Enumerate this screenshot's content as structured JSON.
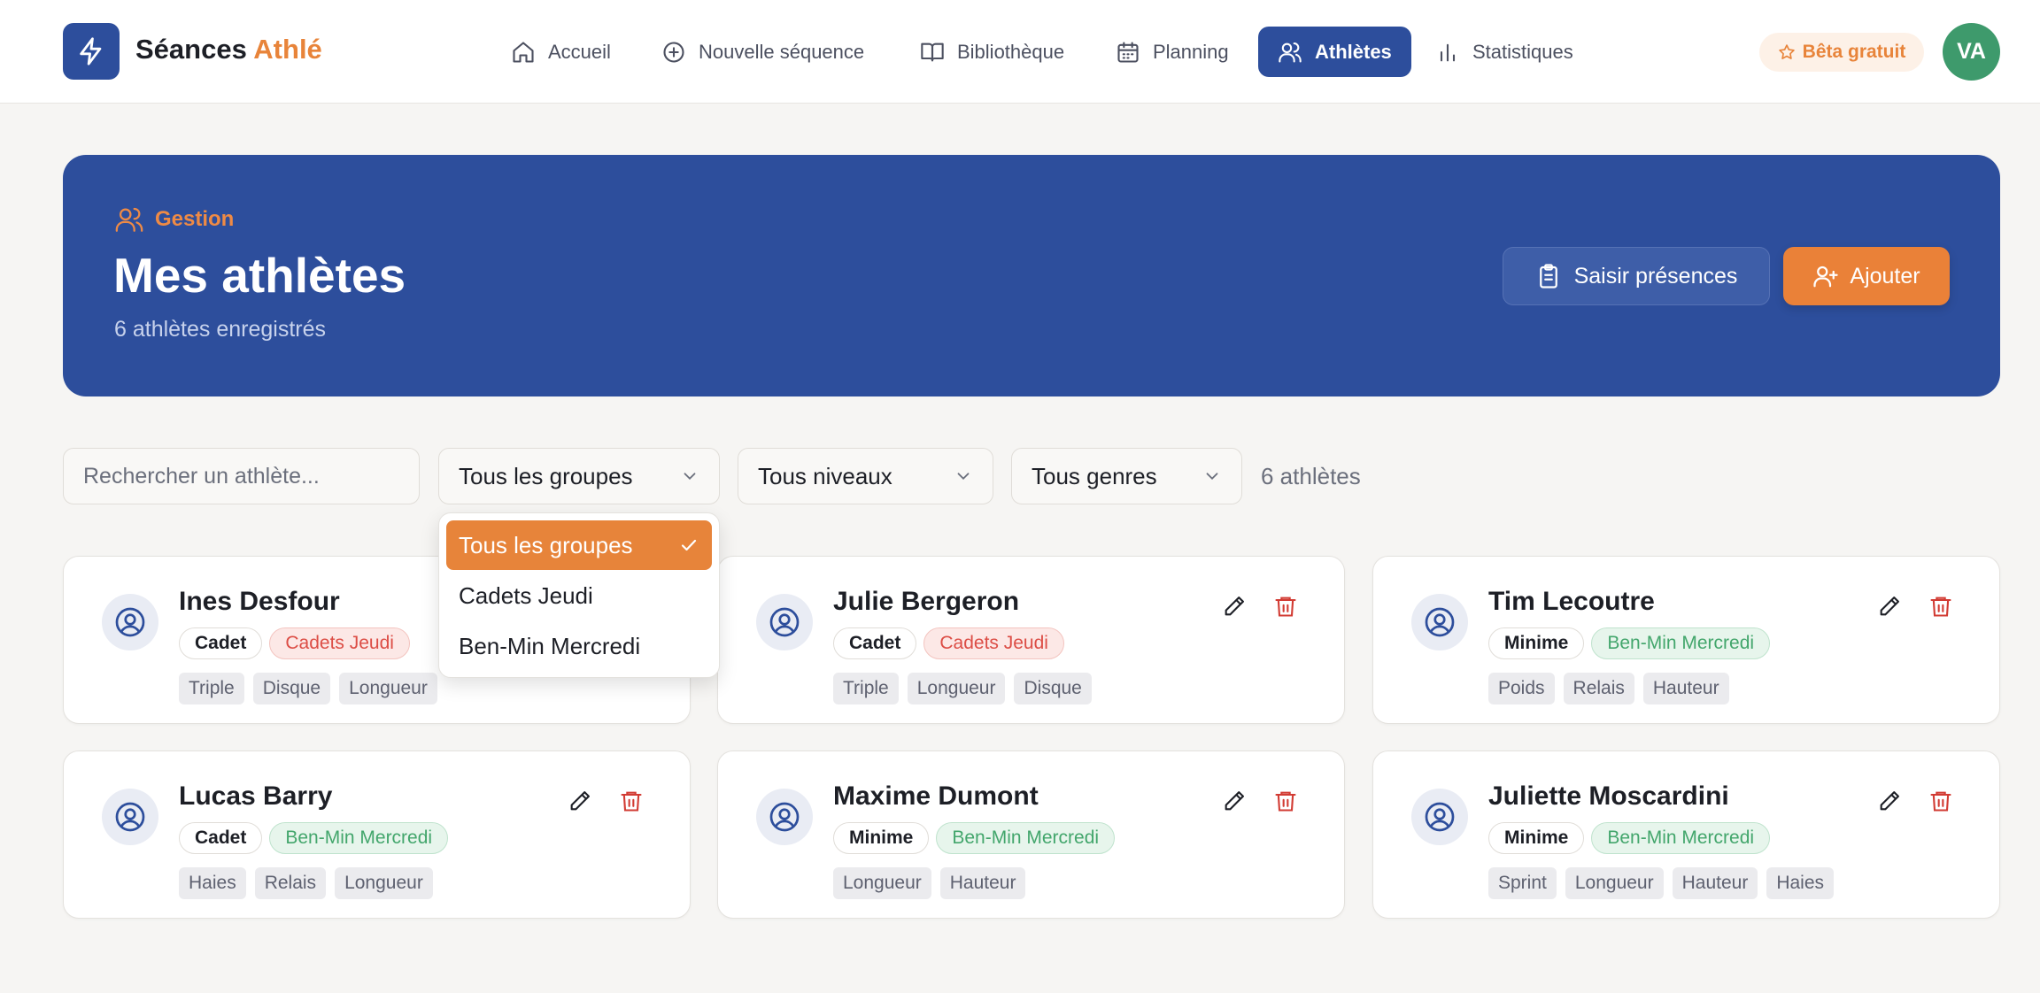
{
  "app": {
    "brand_main": "Séances",
    "brand_accent": "Athlé"
  },
  "nav": {
    "items": [
      {
        "label": "Accueil",
        "icon": "home-icon"
      },
      {
        "label": "Nouvelle séquence",
        "icon": "plus-circle-icon"
      },
      {
        "label": "Bibliothèque",
        "icon": "book-icon"
      },
      {
        "label": "Planning",
        "icon": "calendar-icon"
      },
      {
        "label": "Athlètes",
        "icon": "users-icon",
        "active": true
      },
      {
        "label": "Statistiques",
        "icon": "bar-chart-icon"
      }
    ],
    "beta_label": "Bêta gratuit",
    "avatar_initials": "VA"
  },
  "hero": {
    "eyebrow": "Gestion",
    "title": "Mes athlètes",
    "subtitle": "6 athlètes enregistrés",
    "presence_button": "Saisir présences",
    "add_button": "Ajouter"
  },
  "filters": {
    "search_placeholder": "Rechercher un athlète...",
    "group_select": "Tous les groupes",
    "level_select": "Tous niveaux",
    "gender_select": "Tous genres",
    "count_label": "6 athlètes"
  },
  "group_dropdown": {
    "options": [
      "Tous les groupes",
      "Cadets Jeudi",
      "Ben-Min Mercredi"
    ],
    "selected": "Tous les groupes"
  },
  "athletes": [
    {
      "name": "Ines Desfour",
      "level": "Cadet",
      "group": "Cadets Jeudi",
      "events": [
        "Triple",
        "Disque",
        "Longueur"
      ]
    },
    {
      "name": "Julie Bergeron",
      "level": "Cadet",
      "group": "Cadets Jeudi",
      "events": [
        "Triple",
        "Longueur",
        "Disque"
      ]
    },
    {
      "name": "Tim Lecoutre",
      "level": "Minime",
      "group": "Ben-Min Mercredi",
      "events": [
        "Poids",
        "Relais",
        "Hauteur"
      ]
    },
    {
      "name": "Lucas Barry",
      "level": "Cadet",
      "group": "Ben-Min Mercredi",
      "events": [
        "Haies",
        "Relais",
        "Longueur"
      ]
    },
    {
      "name": "Maxime Dumont",
      "level": "Minime",
      "group": "Ben-Min Mercredi",
      "events": [
        "Longueur",
        "Hauteur"
      ]
    },
    {
      "name": "Juliette Moscardini",
      "level": "Minime",
      "group": "Ben-Min Mercredi",
      "events": [
        "Sprint",
        "Longueur",
        "Hauteur",
        "Haies"
      ]
    }
  ],
  "colors": {
    "primary": "#2d4e9c",
    "accent": "#e8843a",
    "cadets_group": "#dc4d45",
    "benmin_group": "#43a66c",
    "delete": "#d23b33"
  }
}
